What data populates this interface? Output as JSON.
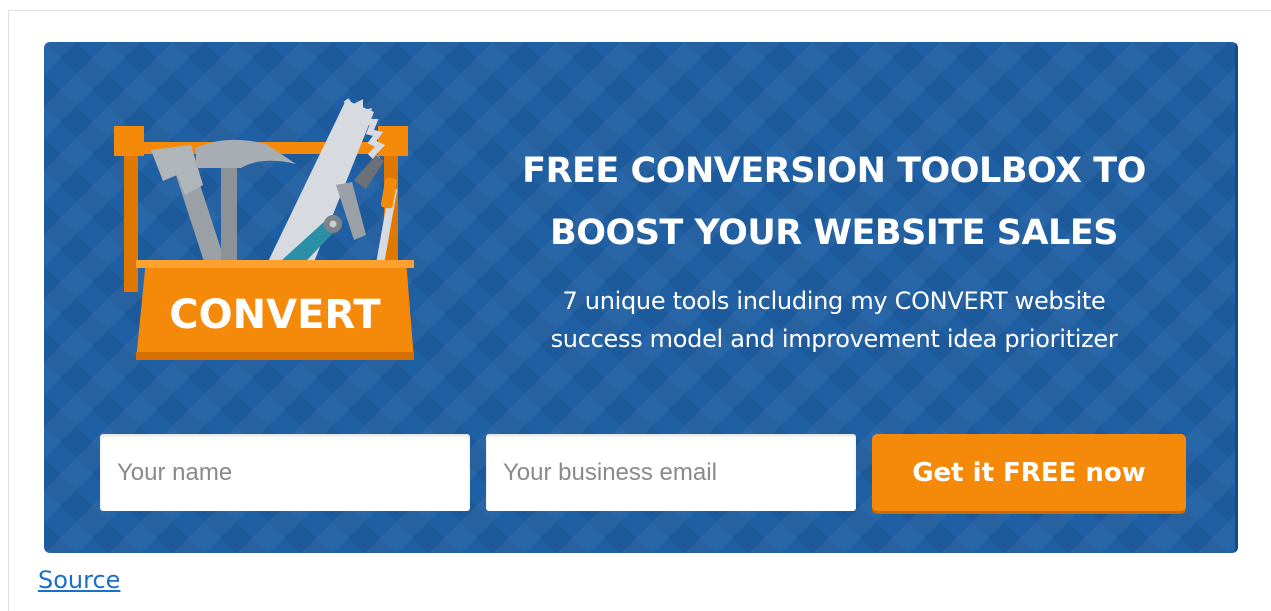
{
  "banner": {
    "headline_line1": "FREE CONVERSION TOOLBOX TO",
    "headline_line2": "BOOST YOUR WEBSITE SALES",
    "subline_line1": "7 unique tools including my CONVERT website",
    "subline_line2": "success model and improvement idea prioritizer",
    "toolbox_label": "CONVERT",
    "colors": {
      "background": "#1f5fa3",
      "accent": "#f58a0a",
      "text": "#ffffff"
    }
  },
  "form": {
    "name_placeholder": "Your name",
    "name_value": "",
    "email_placeholder": "Your business email",
    "email_value": "",
    "submit_label": "Get it FREE now"
  },
  "footer": {
    "source_link": "Source"
  }
}
